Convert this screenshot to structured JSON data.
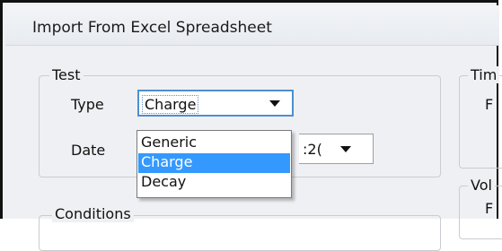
{
  "window": {
    "title": "Import From Excel Spreadsheet"
  },
  "test_group": {
    "legend": "Test",
    "type_label": "Type",
    "type_value": "Charge",
    "date_label": "Date",
    "date_value_partial": ":2(",
    "dropdown_options": [
      "Generic",
      "Charge",
      "Decay"
    ],
    "selected_option": "Charge"
  },
  "conditions_group": {
    "legend": "Conditions"
  },
  "right_groups": {
    "time_legend": "Tim",
    "time_label": "F",
    "voltage_legend": "Vol",
    "voltage_label": "F"
  },
  "colors": {
    "selection": "#3399ff",
    "focus_border": "#4d8fd1",
    "dialog_bg": "#eff0f3"
  }
}
